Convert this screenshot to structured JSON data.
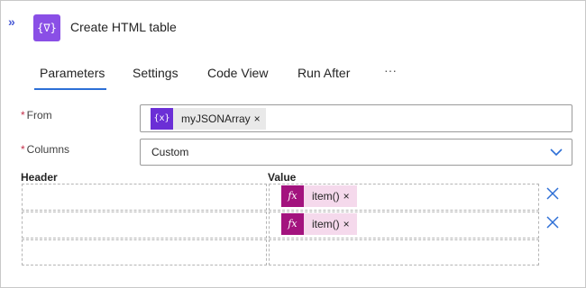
{
  "header": {
    "title": "Create HTML table",
    "icon": "variable-icon",
    "icon_text": "{∇}"
  },
  "tabs": [
    {
      "label": "Parameters",
      "active": true
    },
    {
      "label": "Settings"
    },
    {
      "label": "Code View"
    },
    {
      "label": "Run After"
    },
    {
      "label": "···"
    }
  ],
  "from": {
    "label": "From",
    "required": true,
    "token": {
      "icon": "variable-icon",
      "icon_text": "{x}",
      "label": "myJSONArray",
      "remove": "×"
    }
  },
  "columns": {
    "label": "Columns",
    "required": true,
    "value": "Custom"
  },
  "table": {
    "header_label": "Header",
    "value_label": "Value",
    "rows": [
      {
        "header": "",
        "value": {
          "icon": "function-icon",
          "icon_text": "fx",
          "label": "item()",
          "remove": "×"
        }
      },
      {
        "header": "",
        "value": {
          "icon": "function-icon",
          "icon_text": "fx",
          "label": "item()",
          "remove": "×"
        }
      },
      {
        "header": "",
        "value": null
      }
    ]
  },
  "colors": {
    "accent": "#2d6fd6",
    "action_icon": "#8a4fe6",
    "variable_token": "#6b2fd6",
    "function_token": "#a3137e",
    "required": "#c4314b"
  }
}
